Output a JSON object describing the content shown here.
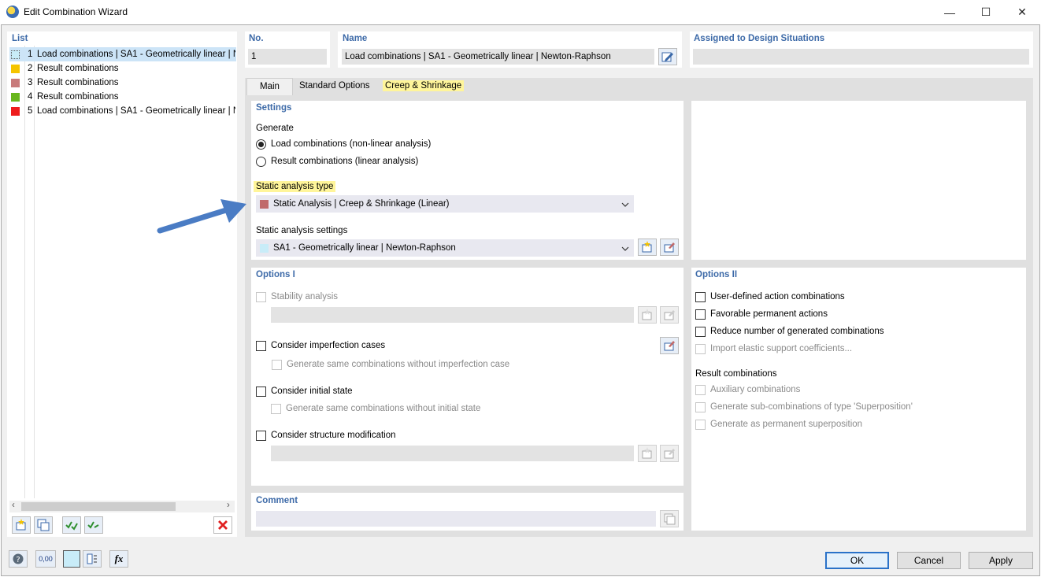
{
  "window": {
    "title": "Edit Combination Wizard",
    "minimize_glyph": "—",
    "maximize_glyph": "☐",
    "close_glyph": "✕"
  },
  "list": {
    "header": "List",
    "items": [
      {
        "num": "1",
        "label": "Load combinations | SA1 - Geometrically linear | N",
        "color": "#c8ecf8",
        "selected": true
      },
      {
        "num": "2",
        "label": "Result combinations",
        "color": "#f5c400"
      },
      {
        "num": "3",
        "label": "Result combinations",
        "color": "#c87b7b"
      },
      {
        "num": "4",
        "label": "Result combinations",
        "color": "#68b61c"
      },
      {
        "num": "5",
        "label": "Load combinations | SA1 - Geometrically linear | N",
        "color": "#ee1c1c"
      }
    ]
  },
  "header": {
    "no_label": "No.",
    "no_value": "1",
    "name_label": "Name",
    "name_value": "Load combinations | SA1 - Geometrically linear | Newton-Raphson",
    "assigned_label": "Assigned to Design Situations",
    "assigned_value": ""
  },
  "tabs": [
    {
      "label": "Main",
      "active": true
    },
    {
      "label": "Standard Options"
    },
    {
      "label": "Creep & Shrinkage",
      "highlighted": true
    }
  ],
  "settings": {
    "title": "Settings",
    "generate_label": "Generate",
    "radio_load": "Load combinations (non-linear analysis)",
    "radio_result": "Result combinations (linear analysis)",
    "selected_radio": "load",
    "static_type_label": "Static analysis type",
    "static_type_value": "Static Analysis | Creep & Shrinkage (Linear)",
    "static_type_color": "#c06a6a",
    "static_settings_label": "Static analysis settings",
    "static_settings_value": "SA1 - Geometrically linear | Newton-Raphson",
    "static_settings_color": "#c8ecf8"
  },
  "options1": {
    "title": "Options I",
    "stability": "Stability analysis",
    "imperfection": "Consider imperfection cases",
    "imperfection_sub": "Generate same combinations without imperfection case",
    "initial_state": "Consider initial state",
    "initial_state_sub": "Generate same combinations without initial state",
    "structure_mod": "Consider structure modification"
  },
  "options2": {
    "title": "Options II",
    "user_defined": "User-defined action combinations",
    "favorable": "Favorable permanent actions",
    "reduce": "Reduce number of generated combinations",
    "import_elastic": "Import elastic support coefficients...",
    "result_combinations_label": "Result combinations",
    "auxiliary": "Auxiliary combinations",
    "sub_combinations": "Generate sub-combinations of type 'Superposition'",
    "permanent_superposition": "Generate as permanent superposition"
  },
  "comment": {
    "title": "Comment",
    "value": ""
  },
  "footer": {
    "ok": "OK",
    "cancel": "Cancel",
    "apply": "Apply"
  },
  "icons": {
    "help": "help-icon",
    "units": "units-icon",
    "units_text": "0,00",
    "color": "color-swatch-icon",
    "view": "view-icon",
    "formula": "formula-icon",
    "formula_text": "fx"
  }
}
